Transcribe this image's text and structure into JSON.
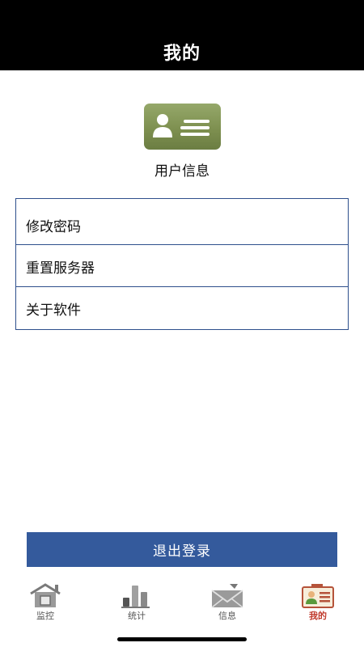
{
  "header": {
    "title": "我的"
  },
  "profile": {
    "label": "用户信息",
    "icon": "user-card-icon",
    "card_color": "#7e9050"
  },
  "menu": {
    "items": [
      {
        "label": "修改密码"
      },
      {
        "label": "重置服务器"
      },
      {
        "label": "关于软件"
      }
    ],
    "border_color": "#2e4f8c"
  },
  "logout": {
    "label": "退出登录",
    "color": "#345a9c"
  },
  "tabbar": {
    "active_color": "#c0392b",
    "tabs": [
      {
        "label": "监控",
        "icon": "monitor-house-icon"
      },
      {
        "label": "统计",
        "icon": "bar-chart-icon"
      },
      {
        "label": "信息",
        "icon": "envelope-icon"
      },
      {
        "label": "我的",
        "icon": "profile-card-icon",
        "active": true
      }
    ]
  }
}
